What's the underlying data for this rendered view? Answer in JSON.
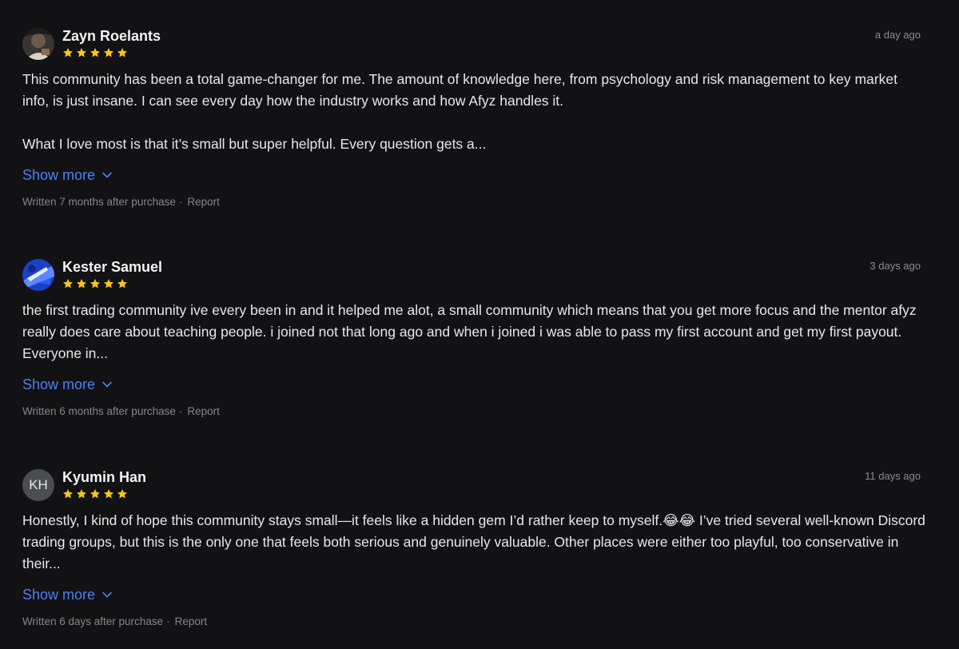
{
  "reviews": [
    {
      "name": "Zayn Roelants",
      "time": "a day ago",
      "rating": 5,
      "avatar": "photo",
      "body": "This community has been a total game-changer for me. The amount of knowledge here, from psychology and risk management to key market info, is just insane. I can see every day how the industry works and how Afyz handles it.\n\nWhat I love most is that it’s small but super helpful. Every question gets a...",
      "show_more": "Show more",
      "written": "Written 7 months after purchase",
      "separator": "·",
      "report": "Report"
    },
    {
      "name": "Kester Samuel",
      "time": "3 days ago",
      "rating": 5,
      "avatar": "photo",
      "body": "the first trading community ive every been in and it helped me alot, a small community which means that you get more focus and the mentor afyz really does care about teaching people. i joined not that long ago and when i joined i was able to pass my first account and get my first payout. Everyone in...",
      "show_more": "Show more",
      "written": "Written 6 months after purchase",
      "separator": "·",
      "report": "Report"
    },
    {
      "name": "Kyumin Han",
      "time": "11 days ago",
      "rating": 5,
      "avatar_initials": "KH",
      "body": "Honestly, I kind of hope this community stays small—it feels like a hidden gem I’d rather keep to myself.😂😂 I’ve tried several well-known Discord trading groups, but this is the only one that feels both serious and genuinely valuable. Other places were either too playful, too conservative in their...",
      "show_more": "Show more",
      "written": "Written 6 days after purchase",
      "separator": "·",
      "report": "Report"
    }
  ],
  "colors": {
    "background": "#121214",
    "star": "#f5c518",
    "link": "#4f7ff2",
    "muted": "#86868a"
  },
  "icons": {
    "star": "star-icon",
    "chevron": "chevron-down-icon"
  }
}
